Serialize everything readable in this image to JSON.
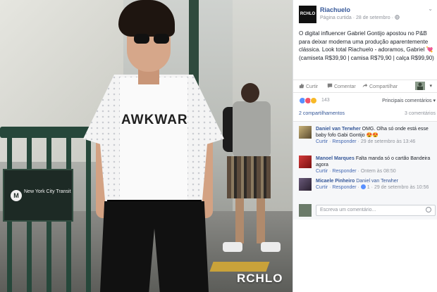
{
  "photo": {
    "tee_text": "AWKWAR",
    "sign_logo": "M",
    "sign_text": "New York City Transit",
    "watermark": "RCHLO"
  },
  "page": {
    "logo_text": "RCHLO",
    "name": "Riachuelo",
    "meta": "Página curtida · 28 de setembro ·",
    "menu_chevron": "⌄"
  },
  "post": {
    "text": "O digital influencer Gabriel Gontijo apostou no P&B para deixar moderna uma produção aparentemente clássica. Look total Riachuelo - adoramos, Gabriel 💘 (camiseta R$39,90 | camisa R$79,90 | calça R$99,90)"
  },
  "actions": {
    "like": "Curtir",
    "comment": "Comentar",
    "share": "Compartilhar",
    "chevron": "▾"
  },
  "reactions": {
    "count": "143",
    "filter": "Principais comentários ▾"
  },
  "stats": {
    "shares": "2 compartilhamentos",
    "comments": "3 comentários"
  },
  "comments": [
    {
      "author": "Daniel van Terwher",
      "text": "OMG. Olha só onde está esse baby fofo Gabi Gontijo 😍😍",
      "like": "Curtir",
      "reply": "Responder",
      "time": "29 de setembro às 13:46"
    },
    {
      "author": "Manoel Marques",
      "text": "Falta manda só o cartão Bandeira agora",
      "like": "Curtir",
      "reply": "Responder",
      "time": "Ontem às 08:50"
    },
    {
      "author": "Micaele Pinheiro",
      "text": "Daniel van Terwher",
      "like": "Curtir",
      "reply": "Responder",
      "likes": "1",
      "time": "29 de setembro às 10:56"
    }
  ],
  "composer": {
    "placeholder": "Escreva um comentário..."
  },
  "colors": {
    "link": "#365899",
    "like_blue": "#5890ff",
    "love_red": "#f25268",
    "haha_yellow": "#f7b928"
  }
}
